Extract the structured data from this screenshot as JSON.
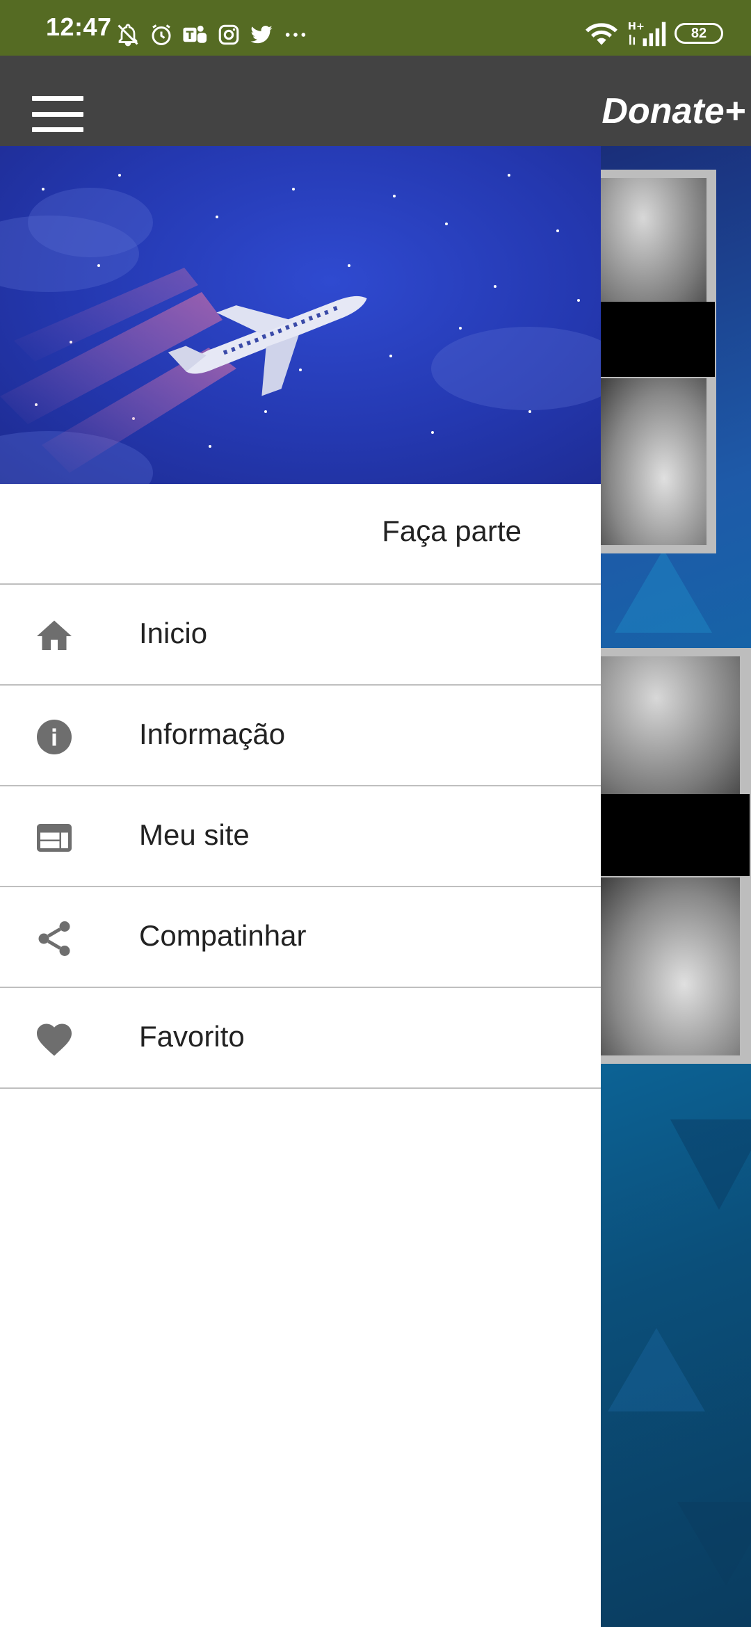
{
  "status_bar": {
    "time": "12:47",
    "battery": "82",
    "icons": [
      "mute-icon",
      "alarm-icon",
      "teams-icon",
      "instagram-icon",
      "twitter-icon",
      "more-icon",
      "wifi-icon",
      "signal-icon"
    ]
  },
  "app_bar": {
    "title": "Donate+",
    "menu_icon": "hamburger-icon"
  },
  "drawer": {
    "header_image": "airplane-night-sky",
    "join_label": "Faça parte",
    "items": [
      {
        "label": "Inicio",
        "icon": "home-icon"
      },
      {
        "label": "Informação",
        "icon": "info-icon"
      },
      {
        "label": "Meu site",
        "icon": "web-icon"
      },
      {
        "label": "Compatinhar",
        "icon": "share-icon"
      },
      {
        "label": "Favorito",
        "icon": "heart-icon"
      }
    ]
  },
  "colors": {
    "status_bar": "#556b23",
    "app_bar": "#434343",
    "drawer_header": "#2438b0",
    "icon_gray": "#6e6e6e",
    "divider": "#bfbfbf"
  }
}
